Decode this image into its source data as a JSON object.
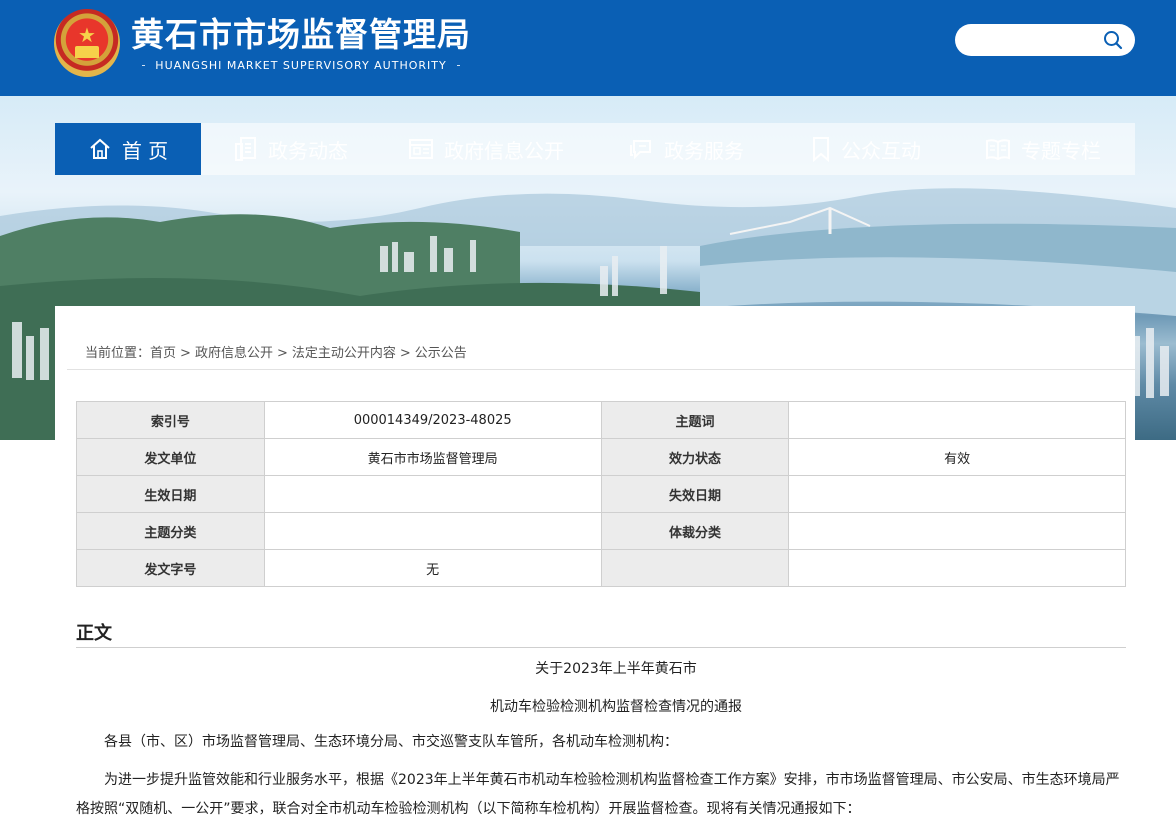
{
  "header": {
    "title": "黄石市市场监督管理局",
    "subtitle": "HUANGSHI MARKET SUPERVISORY AUTHORITY",
    "search_placeholder": ""
  },
  "nav": {
    "items": [
      {
        "label": "首 页",
        "icon": "home-icon",
        "active": true
      },
      {
        "label": "政务动态",
        "icon": "news-icon"
      },
      {
        "label": "政府信息公开",
        "icon": "info-open-icon"
      },
      {
        "label": "政务服务",
        "icon": "service-icon"
      },
      {
        "label": "公众互动",
        "icon": "bookmark-icon"
      },
      {
        "label": "专题专栏",
        "icon": "book-icon"
      }
    ]
  },
  "breadcrumb": {
    "prefix": "当前位置：",
    "items": [
      "首页",
      "政府信息公开",
      "法定主动公开内容",
      "公示公告"
    ],
    "separator": ">"
  },
  "meta_table": {
    "rows": [
      {
        "l1": "索引号",
        "v1": "000014349/2023-48025",
        "l2": "主题词",
        "v2": ""
      },
      {
        "l1": "发文单位",
        "v1": "黄石市市场监督管理局",
        "l2": "效力状态",
        "v2": "有效"
      },
      {
        "l1": "生效日期",
        "v1": "",
        "l2": "失效日期",
        "v2": ""
      },
      {
        "l1": "主题分类",
        "v1": "",
        "l2": "体裁分类",
        "v2": ""
      },
      {
        "l1": "发文字号",
        "v1": "无",
        "l2": "",
        "v2": ""
      }
    ]
  },
  "body": {
    "heading": "正文",
    "title_line1": "关于2023年上半年黄石市",
    "title_line2": "机动车检验检测机构监督检查情况的通报",
    "para1": "各县（市、区）市场监督管理局、生态环境分局、市交巡警支队车管所，各机动车检测机构：",
    "para2": "为进一步提升监管效能和行业服务水平，根据《2023年上半年黄石市机动车检验检测机构监督检查工作方案》安排，市市场监督管理局、市公安局、市生态环境局严格按照“双随机、一公开”要求，联合对全市机动车检验检测机构（以下简称车检机构）开展监督检查。现将有关情况通报如下："
  },
  "colors": {
    "brand_blue": "#0a5fb4",
    "table_label_bg": "#ececec"
  }
}
